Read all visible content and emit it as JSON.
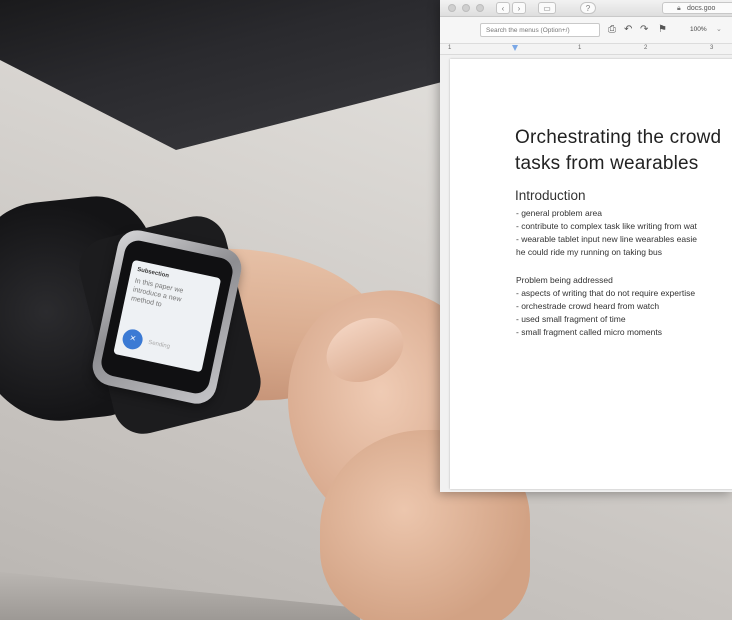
{
  "browser": {
    "url": "docs.goo",
    "menu_search_placeholder": "Search the menus (Option+/)",
    "zoom": "100%",
    "ruler_numbers": [
      "1",
      "1",
      "2",
      "3"
    ]
  },
  "document": {
    "title_line1": "Orchestrating the crowd",
    "title_line2": "tasks from wearables",
    "heading": "Introduction",
    "intro_lines": [
      "- general problem area",
      "- contribute to complex task like writing from wat",
      "- wearable tablet input new line wearables easie",
      "he could ride my running on taking bus"
    ],
    "subheading": "Problem being addressed",
    "problem_lines": [
      "- aspects of writing that do not require expertise",
      "- orchestrade crowd heard from watch",
      "- used small fragment of time",
      "- small fragment called micro moments"
    ]
  },
  "watch": {
    "title": "Subsection",
    "text": "In this paper we introduce a new method to",
    "button_icon": "×",
    "button_label": "Sending"
  },
  "colors": {
    "watch_button": "#3b7ad4",
    "ruler_marker": "#7aa7e6"
  }
}
